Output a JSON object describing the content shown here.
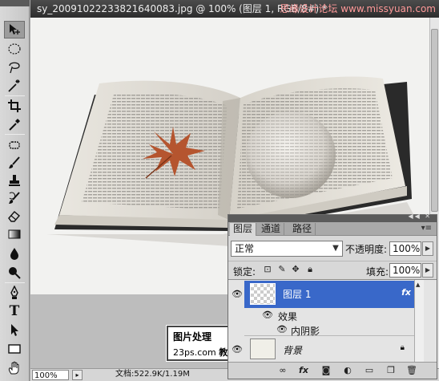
{
  "document": {
    "title": "sy_20091022233821640083.jpg @ 100% (图层 1, RGB/8#) *",
    "watermark_top": "思缘设计论坛 www.missyuan.com"
  },
  "stamp": {
    "line1": "图片处理",
    "line2_a": "23ps.com",
    "line2_b": "教程网"
  },
  "statusbar": {
    "zoom": "100%",
    "doc_info": "文档:522.9K/1.19M"
  },
  "toolbox": {
    "tools": [
      "move-tool",
      "marquee-tool",
      "lasso-tool",
      "magic-wand-tool",
      "crop-tool",
      "eyedropper-tool",
      "healing-brush-tool",
      "brush-tool",
      "clone-stamp-tool",
      "history-brush-tool",
      "eraser-tool",
      "gradient-tool",
      "blur-tool",
      "dodge-tool",
      "pen-tool",
      "type-tool",
      "path-selection-tool",
      "rectangle-tool",
      "hand-tool"
    ],
    "type_tool_glyph": "T"
  },
  "layers_panel": {
    "tabs": [
      "图层",
      "通道",
      "路径"
    ],
    "blend_mode": "正常",
    "opacity_label": "不透明度:",
    "opacity_value": "100%",
    "lock_label": "锁定:",
    "fill_label": "填充:",
    "fill_value": "100%",
    "layers": [
      {
        "name": "图层 1",
        "fx": "fx",
        "selected": true
      },
      {
        "name": "背景",
        "locked": true
      }
    ],
    "effects_label": "效果",
    "inner_shadow_label": "内阴影",
    "footer_icons": [
      "link-icon",
      "fx-icon",
      "mask-icon",
      "adjustment-icon",
      "group-icon",
      "new-layer-icon",
      "trash-icon"
    ],
    "footer_fx_label": "fx"
  },
  "colors": {
    "selected_layer": "#3968c9",
    "panel_bg": "#d8d8d8",
    "titlebar": "#3a3a3a"
  }
}
